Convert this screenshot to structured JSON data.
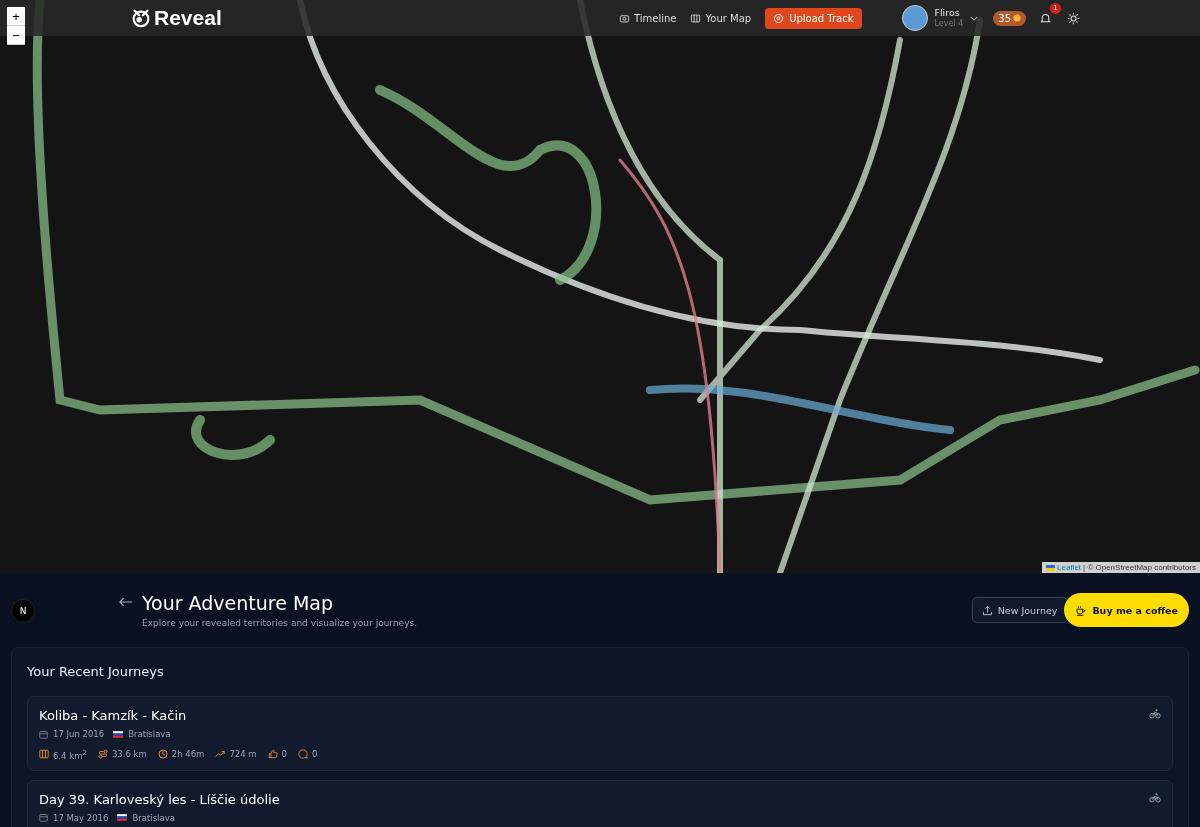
{
  "map": {
    "zoom_controls": [
      "+",
      "−"
    ],
    "attribution": {
      "link": "Leaflet",
      "text": "| © OpenStreetMap contributors"
    }
  },
  "header": {
    "logo": "Reveal",
    "nav": [
      {
        "label": "Timeline",
        "kind": "camera"
      },
      {
        "label": "Your Map",
        "kind": "map"
      }
    ],
    "upload_button": "Upload Track",
    "user": {
      "name": "Fliros",
      "level": "Level 4"
    },
    "points": "35",
    "notifications": "1"
  },
  "page": {
    "avatar_letter": "N",
    "title": "Your Adventure Map",
    "subtitle": "Explore your revealed territories and visualize your journeys.",
    "new_journey_button": "New Journey",
    "coffee_button": "Buy me a coffee"
  },
  "recent": {
    "title": "Your Recent Journeys",
    "journeys": [
      {
        "title": "Koliba - Kamzík - Kačin",
        "date": "17 Jun 2016",
        "place": "Bratislava",
        "kind": "bike",
        "stats": [
          {
            "kind": "area",
            "value": "6.4 km$^{2}$"
          },
          {
            "kind": "distance",
            "value": "33.6 km"
          },
          {
            "kind": "time",
            "value": "2h 46m"
          },
          {
            "kind": "elevation",
            "value": "724 m"
          },
          {
            "kind": "likes",
            "value": "0"
          },
          {
            "kind": "comments",
            "value": "0"
          }
        ]
      },
      {
        "title": "Day 39. Karloveský les - Líščie údolie",
        "date": "17 May 2016",
        "place": "Bratislava",
        "kind": "bike"
      }
    ]
  }
}
